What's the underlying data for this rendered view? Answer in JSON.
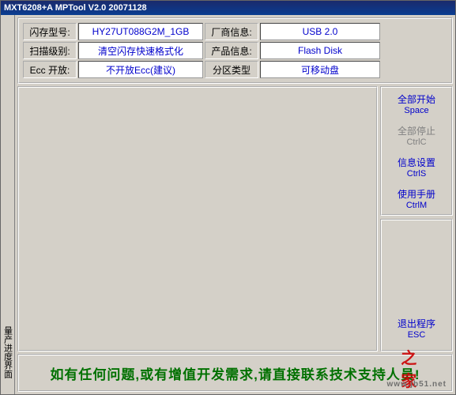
{
  "titlebar": "MXT6208+A  MPTool  V2.0  20071128",
  "leftstrip": "量产进度界面",
  "info": {
    "flash_model_label": "闪存型号:",
    "flash_model_value": "HY27UT088G2M_1GB",
    "vendor_label": "厂商信息:",
    "vendor_value": "USB 2.0",
    "scan_label": "扫描级别:",
    "scan_value": "清空闪存快速格式化",
    "product_label": "产品信息:",
    "product_value": "Flash Disk",
    "ecc_label": "Ecc 开放:",
    "ecc_value": "不开放Ecc(建议)",
    "part_label": "分区类型",
    "part_value": "可移动盘"
  },
  "sidebar": {
    "start": {
      "line1": "全部开始",
      "line2": "Space"
    },
    "stop": {
      "line1": "全部停止",
      "line2": "CtrlC"
    },
    "cfg": {
      "line1": "信息设置",
      "line2": "CtrlS"
    },
    "man": {
      "line1": "使用手册",
      "line2": "CtrlM"
    },
    "exit": {
      "line1": "退出程序",
      "line2": "ESC"
    }
  },
  "footer": "如有任何问题,或有增值开发需求,请直接联系技术支持人员!",
  "watermark": {
    "url": "www.jb51.net"
  }
}
